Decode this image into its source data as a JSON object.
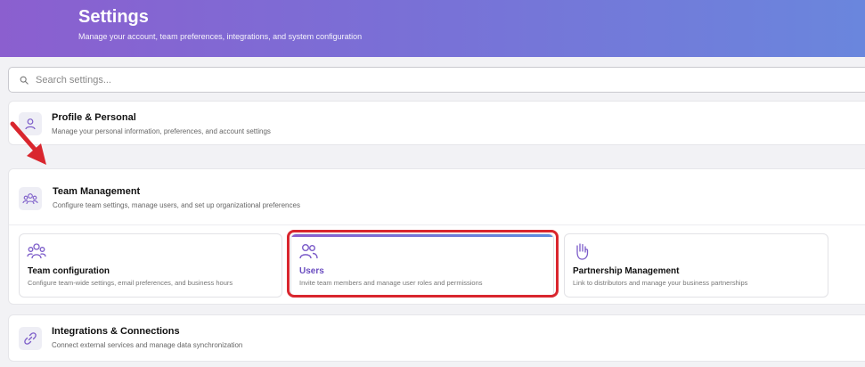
{
  "header": {
    "title": "Settings",
    "subtitle": "Manage your account, team preferences, integrations, and system configuration"
  },
  "search": {
    "placeholder": "Search settings...",
    "icon": "search-icon"
  },
  "sections": {
    "profile": {
      "title": "Profile & Personal",
      "description": "Manage your personal information, preferences, and account settings",
      "icon": "user-icon"
    },
    "team": {
      "title": "Team Management",
      "description": "Configure team settings, manage users, and set up organizational preferences",
      "icon": "team-icon",
      "items": [
        {
          "title": "Team configuration",
          "description": "Configure team-wide settings, email preferences, and business hours",
          "icon": "team-icon"
        },
        {
          "title": "Users",
          "description": "Invite team members and manage user roles and permissions",
          "icon": "users-icon"
        },
        {
          "title": "Partnership Management",
          "description": "Link to distributors and manage your business partnerships",
          "icon": "handshake-icon"
        }
      ]
    },
    "integrations": {
      "title": "Integrations & Connections",
      "description": "Connect external services and manage data synchronization",
      "icon": "link-icon"
    }
  },
  "colors": {
    "accent": "#7c5cc9",
    "highlight": "#d9262e",
    "header_start": "#8b5fcf",
    "header_end": "#6a86dd"
  }
}
